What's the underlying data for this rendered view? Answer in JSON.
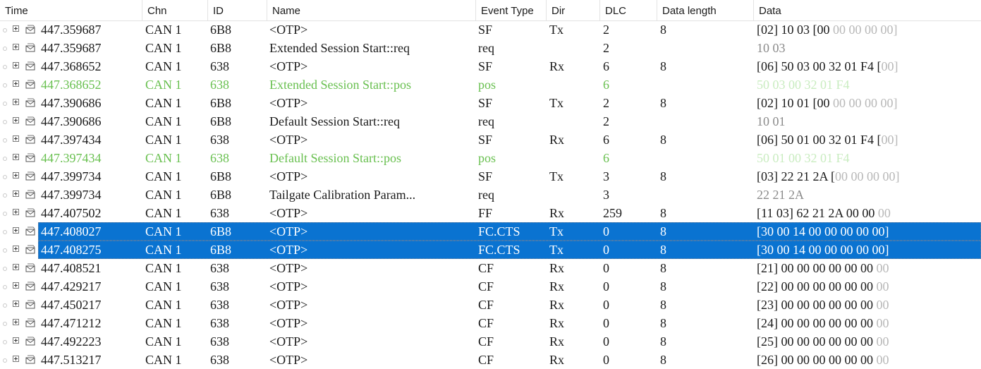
{
  "columns": {
    "time": "Time",
    "chn": "Chn",
    "id": "ID",
    "name": "Name",
    "event_type": "Event Type",
    "dir": "Dir",
    "dlc": "DLC",
    "data_length": "Data length",
    "data": "Data"
  },
  "rows": [
    {
      "time": "447.359687",
      "chn": "CAN 1",
      "id": "6B8",
      "name": "<OTP>",
      "event": "SF",
      "dir": "Tx",
      "dlc": "2",
      "len": "8",
      "data": "[02] 10 03 [00",
      "data_dim": " 00 00 00 00]",
      "data_style": "normal"
    },
    {
      "time": "447.359687",
      "chn": "CAN 1",
      "id": "6B8",
      "name": "Extended Session Start::req",
      "event": "req",
      "dir": "",
      "dlc": "2",
      "len": "",
      "data": "",
      "data_dim": "10 03",
      "data_style": "faint"
    },
    {
      "time": "447.368652",
      "chn": "CAN 1",
      "id": "638",
      "name": "<OTP>",
      "event": "SF",
      "dir": "Rx",
      "dlc": "6",
      "len": "8",
      "data": "[06] 50 03 00 32 01 F4 [",
      "data_dim": "00]",
      "data_style": "normal"
    },
    {
      "time": "447.368652",
      "chn": "CAN 1",
      "id": "638",
      "name": "Extended Session Start::pos",
      "event": "pos",
      "dir": "",
      "dlc": "6",
      "len": "",
      "data": "",
      "data_dim": "50 03 00 32 01 F4",
      "data_style": "faint",
      "green": true
    },
    {
      "time": "447.390686",
      "chn": "CAN 1",
      "id": "6B8",
      "name": "<OTP>",
      "event": "SF",
      "dir": "Tx",
      "dlc": "2",
      "len": "8",
      "data": "[02] 10 01 [00",
      "data_dim": " 00 00 00 00]",
      "data_style": "normal"
    },
    {
      "time": "447.390686",
      "chn": "CAN 1",
      "id": "6B8",
      "name": "Default Session Start::req",
      "event": "req",
      "dir": "",
      "dlc": "2",
      "len": "",
      "data": "",
      "data_dim": "10 01",
      "data_style": "faint"
    },
    {
      "time": "447.397434",
      "chn": "CAN 1",
      "id": "638",
      "name": "<OTP>",
      "event": "SF",
      "dir": "Rx",
      "dlc": "6",
      "len": "8",
      "data": "[06] 50 01 00 32 01 F4 [",
      "data_dim": "00]",
      "data_style": "normal"
    },
    {
      "time": "447.397434",
      "chn": "CAN 1",
      "id": "638",
      "name": "Default Session Start::pos",
      "event": "pos",
      "dir": "",
      "dlc": "6",
      "len": "",
      "data": "",
      "data_dim": "50 01 00 32 01 F4",
      "data_style": "faint",
      "green": true
    },
    {
      "time": "447.399734",
      "chn": "CAN 1",
      "id": "6B8",
      "name": "<OTP>",
      "event": "SF",
      "dir": "Tx",
      "dlc": "3",
      "len": "8",
      "data": "[03] 22 21 2A [",
      "data_dim": "00 00 00 00]",
      "data_style": "normal"
    },
    {
      "time": "447.399734",
      "chn": "CAN 1",
      "id": "6B8",
      "name": "Tailgate Calibration Param...",
      "event": "req",
      "dir": "",
      "dlc": "3",
      "len": "",
      "data": "",
      "data_dim": "22 21 2A",
      "data_style": "faint"
    },
    {
      "time": "447.407502",
      "chn": "CAN 1",
      "id": "638",
      "name": "<OTP>",
      "event": "FF",
      "dir": "Rx",
      "dlc": "259",
      "len": "8",
      "data": "[11 03] 62 21 2A 00 00 ",
      "data_dim": "00",
      "data_style": "normal"
    },
    {
      "time": "447.408027",
      "chn": "CAN 1",
      "id": "6B8",
      "name": "<OTP>",
      "event": "FC.CTS",
      "dir": "Tx",
      "dlc": "0",
      "len": "8",
      "data": "[30 00 14 00 00 00 00 00]",
      "data_dim": "",
      "data_style": "normal",
      "selected": true
    },
    {
      "time": "447.408275",
      "chn": "CAN 1",
      "id": "6B8",
      "name": "<OTP>",
      "event": "FC.CTS",
      "dir": "Tx",
      "dlc": "0",
      "len": "8",
      "data": "[30 00 14 00 00 00 00 00]",
      "data_dim": "",
      "data_style": "normal",
      "selected": true
    },
    {
      "time": "447.408521",
      "chn": "CAN 1",
      "id": "638",
      "name": "<OTP>",
      "event": "CF",
      "dir": "Rx",
      "dlc": "0",
      "len": "8",
      "data": "[21] 00 00 00 00 00 00 ",
      "data_dim": "00",
      "data_style": "normal"
    },
    {
      "time": "447.429217",
      "chn": "CAN 1",
      "id": "638",
      "name": "<OTP>",
      "event": "CF",
      "dir": "Rx",
      "dlc": "0",
      "len": "8",
      "data": "[22] 00 00 00 00 00 00 ",
      "data_dim": "00",
      "data_style": "normal"
    },
    {
      "time": "447.450217",
      "chn": "CAN 1",
      "id": "638",
      "name": "<OTP>",
      "event": "CF",
      "dir": "Rx",
      "dlc": "0",
      "len": "8",
      "data": "[23] 00 00 00 00 00 00 ",
      "data_dim": "00",
      "data_style": "normal"
    },
    {
      "time": "447.471212",
      "chn": "CAN 1",
      "id": "638",
      "name": "<OTP>",
      "event": "CF",
      "dir": "Rx",
      "dlc": "0",
      "len": "8",
      "data": "[24] 00 00 00 00 00 00 ",
      "data_dim": "00",
      "data_style": "normal"
    },
    {
      "time": "447.492223",
      "chn": "CAN 1",
      "id": "638",
      "name": "<OTP>",
      "event": "CF",
      "dir": "Rx",
      "dlc": "0",
      "len": "8",
      "data": "[25] 00 00 00 00 00 00 ",
      "data_dim": "00",
      "data_style": "normal"
    },
    {
      "time": "447.513217",
      "chn": "CAN 1",
      "id": "638",
      "name": "<OTP>",
      "event": "CF",
      "dir": "Rx",
      "dlc": "0",
      "len": "8",
      "data": "[26] 00 00 00 00 00 00 ",
      "data_dim": "00",
      "data_style": "normal"
    }
  ],
  "colors": {
    "selection": "#0a73d1",
    "positive_response": "#69c050",
    "dim_bytes": "#b8b8b8"
  },
  "icons": [
    "row-marker-icon",
    "expand-icon",
    "message-icon"
  ]
}
